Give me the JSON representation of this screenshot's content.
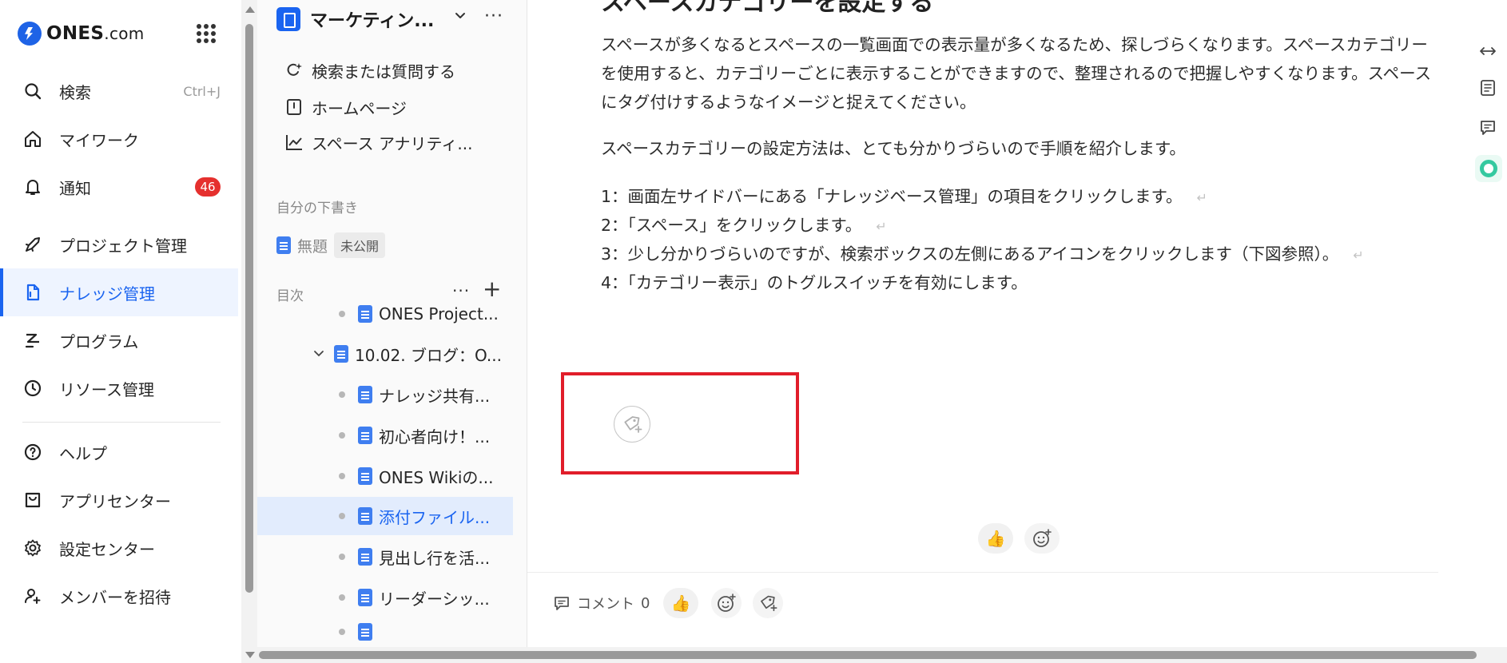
{
  "brand": {
    "name": "ONES",
    "suffix": ".com"
  },
  "nav": {
    "search": {
      "label": "検索",
      "shortcut": "Ctrl+J"
    },
    "mywork": {
      "label": "マイワーク"
    },
    "notify": {
      "label": "通知",
      "badge": "46"
    },
    "project": {
      "label": "プロジェクト管理"
    },
    "knowledge": {
      "label": "ナレッジ管理"
    },
    "program": {
      "label": "プログラム"
    },
    "resource": {
      "label": "リソース管理"
    },
    "help": {
      "label": "ヘルプ"
    },
    "appcenter": {
      "label": "アプリセンター"
    },
    "settings": {
      "label": "設定センター"
    },
    "invite": {
      "label": "メンバーを招待"
    }
  },
  "space": {
    "title": "マーケティン...",
    "search": "検索または質問する",
    "home": "ホームページ",
    "analytics": "スペース アナリティ...",
    "drafts_label": "自分の下書き",
    "draft_title": "無題",
    "draft_tag": "未公開",
    "toc_label": "目次",
    "toc": [
      "ONES Project...",
      "10.02. ブログ：O...",
      "ナレッジ共有...",
      "初心者向け！...",
      "ONES Wikiの...",
      "添付ファイル...",
      "見出し行を活...",
      "リーダーシッ..."
    ]
  },
  "doc": {
    "heading_cut": "スペースカテゴリーを設定する",
    "p1": "スペースが多くなるとスペースの一覧画面での表示量が多くなるため、探しづらくなります。スペースカテゴリーを使用すると、カテゴリーごとに表示することができますので、整理されるので把握しやすくなります。スペースにタグ付けするようなイメージと捉えてください。",
    "p2": "スペースカテゴリーの設定方法は、とても分かりづらいので手順を紹介します。",
    "steps": [
      "1：画面左サイドバーにある「ナレッジベース管理」の項目をクリックします。",
      "2：「スペース」をクリックします。",
      "3：少し分かりづらいのですが、検索ボックスの左側にあるアイコンをクリックします（下図参照）。",
      "4：「カテゴリー表示」のトグルスイッチを有効にします。"
    ],
    "return_mark": "↵",
    "like_emoji": "👍"
  },
  "comments": {
    "label": "コメント",
    "count": "0"
  },
  "colors": {
    "accent": "#1a64f0",
    "highlight": "#e11d2a",
    "badge": "#e5302e"
  }
}
